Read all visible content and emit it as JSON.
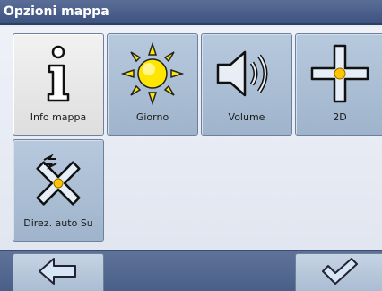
{
  "window": {
    "title": "Opzioni mappa"
  },
  "tiles": [
    {
      "label": "Info mappa",
      "icon": "info-icon",
      "selected": true
    },
    {
      "label": "Giorno",
      "icon": "sun-icon",
      "selected": false
    },
    {
      "label": "Volume",
      "icon": "speaker-icon",
      "selected": false
    },
    {
      "label": "2D",
      "icon": "cross-2d-icon",
      "selected": false
    },
    {
      "label": "Direz. auto Su",
      "icon": "auto-heading-icon",
      "selected": false
    }
  ],
  "nav": {
    "back_icon": "arrow-left-icon",
    "ok_icon": "checkmark-icon"
  },
  "colors": {
    "titlebar": "#3d5280",
    "tile": "#a9bcd2",
    "tile_selected": "#e8e8e8",
    "sun": "#ffe600",
    "accent_dot": "#ffc400"
  }
}
